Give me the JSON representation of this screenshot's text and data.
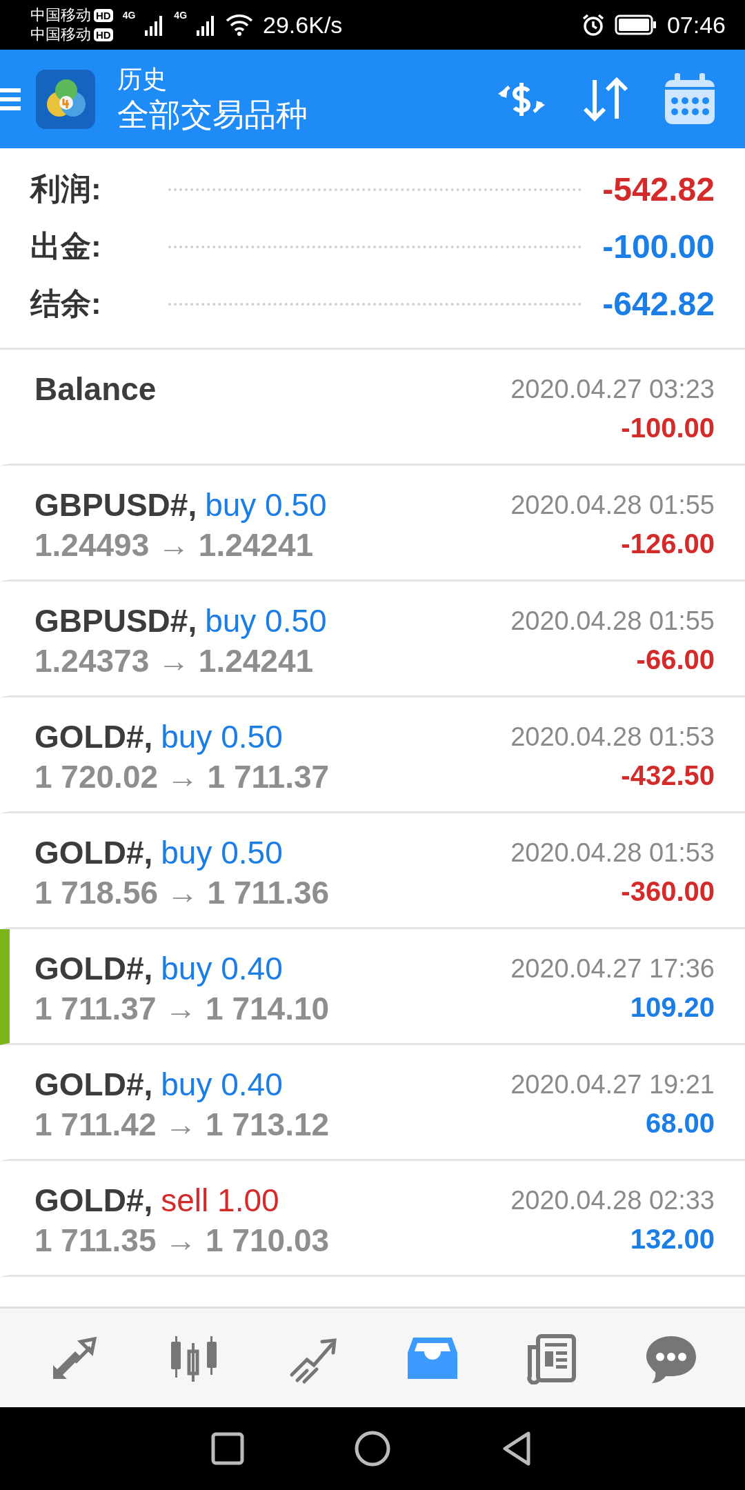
{
  "status_bar": {
    "carriers": [
      {
        "name": "中国移动",
        "badge": "HD"
      },
      {
        "name": "中国移动",
        "badge": "HD"
      }
    ],
    "networks": [
      "4G",
      "4G"
    ],
    "speed": "29.6K/s",
    "time": "07:46"
  },
  "header": {
    "title": "历史",
    "subtitle": "全部交易品种"
  },
  "summary": [
    {
      "label": "利润:",
      "value": "-542.82",
      "loss": true
    },
    {
      "label": "出金:",
      "value": "-100.00",
      "loss": false
    },
    {
      "label": "结余:",
      "value": "-642.82",
      "loss": false
    }
  ],
  "rows": [
    {
      "kind": "balance",
      "title": "Balance",
      "time": "2020.04.27 03:23",
      "profit": "-100.00",
      "loss": true,
      "selected": false
    },
    {
      "kind": "trade",
      "symbol": "GBPUSD#,",
      "action": "buy 0.50",
      "sell": false,
      "prices": "1.24493 → 1.24241",
      "time": "2020.04.28 01:55",
      "profit": "-126.00",
      "loss": true,
      "selected": false
    },
    {
      "kind": "trade",
      "symbol": "GBPUSD#,",
      "action": "buy 0.50",
      "sell": false,
      "prices": "1.24373 → 1.24241",
      "time": "2020.04.28 01:55",
      "profit": "-66.00",
      "loss": true,
      "selected": false
    },
    {
      "kind": "trade",
      "symbol": "GOLD#,",
      "action": "buy 0.50",
      "sell": false,
      "prices": "1 720.02 → 1 711.37",
      "time": "2020.04.28 01:53",
      "profit": "-432.50",
      "loss": true,
      "selected": false
    },
    {
      "kind": "trade",
      "symbol": "GOLD#,",
      "action": "buy 0.50",
      "sell": false,
      "prices": "1 718.56 → 1 711.36",
      "time": "2020.04.28 01:53",
      "profit": "-360.00",
      "loss": true,
      "selected": false
    },
    {
      "kind": "trade",
      "symbol": "GOLD#,",
      "action": "buy 0.40",
      "sell": false,
      "prices": "1 711.37 → 1 714.10",
      "time": "2020.04.27 17:36",
      "profit": "109.20",
      "loss": false,
      "selected": true
    },
    {
      "kind": "trade",
      "symbol": "GOLD#,",
      "action": "buy 0.40",
      "sell": false,
      "prices": "1 711.42 → 1 713.12",
      "time": "2020.04.27 19:21",
      "profit": "68.00",
      "loss": false,
      "selected": false
    },
    {
      "kind": "trade",
      "symbol": "GOLD#,",
      "action": "sell 1.00",
      "sell": true,
      "prices": "1 711.35 → 1 710.03",
      "time": "2020.04.28 02:33",
      "profit": "132.00",
      "loss": false,
      "selected": false
    }
  ],
  "nav": [
    {
      "kind": "trade",
      "selected": false
    },
    {
      "kind": "candles",
      "selected": false
    },
    {
      "kind": "chart",
      "selected": false
    },
    {
      "kind": "history",
      "selected": true
    },
    {
      "kind": "news",
      "selected": false
    },
    {
      "kind": "chat",
      "selected": false
    }
  ]
}
